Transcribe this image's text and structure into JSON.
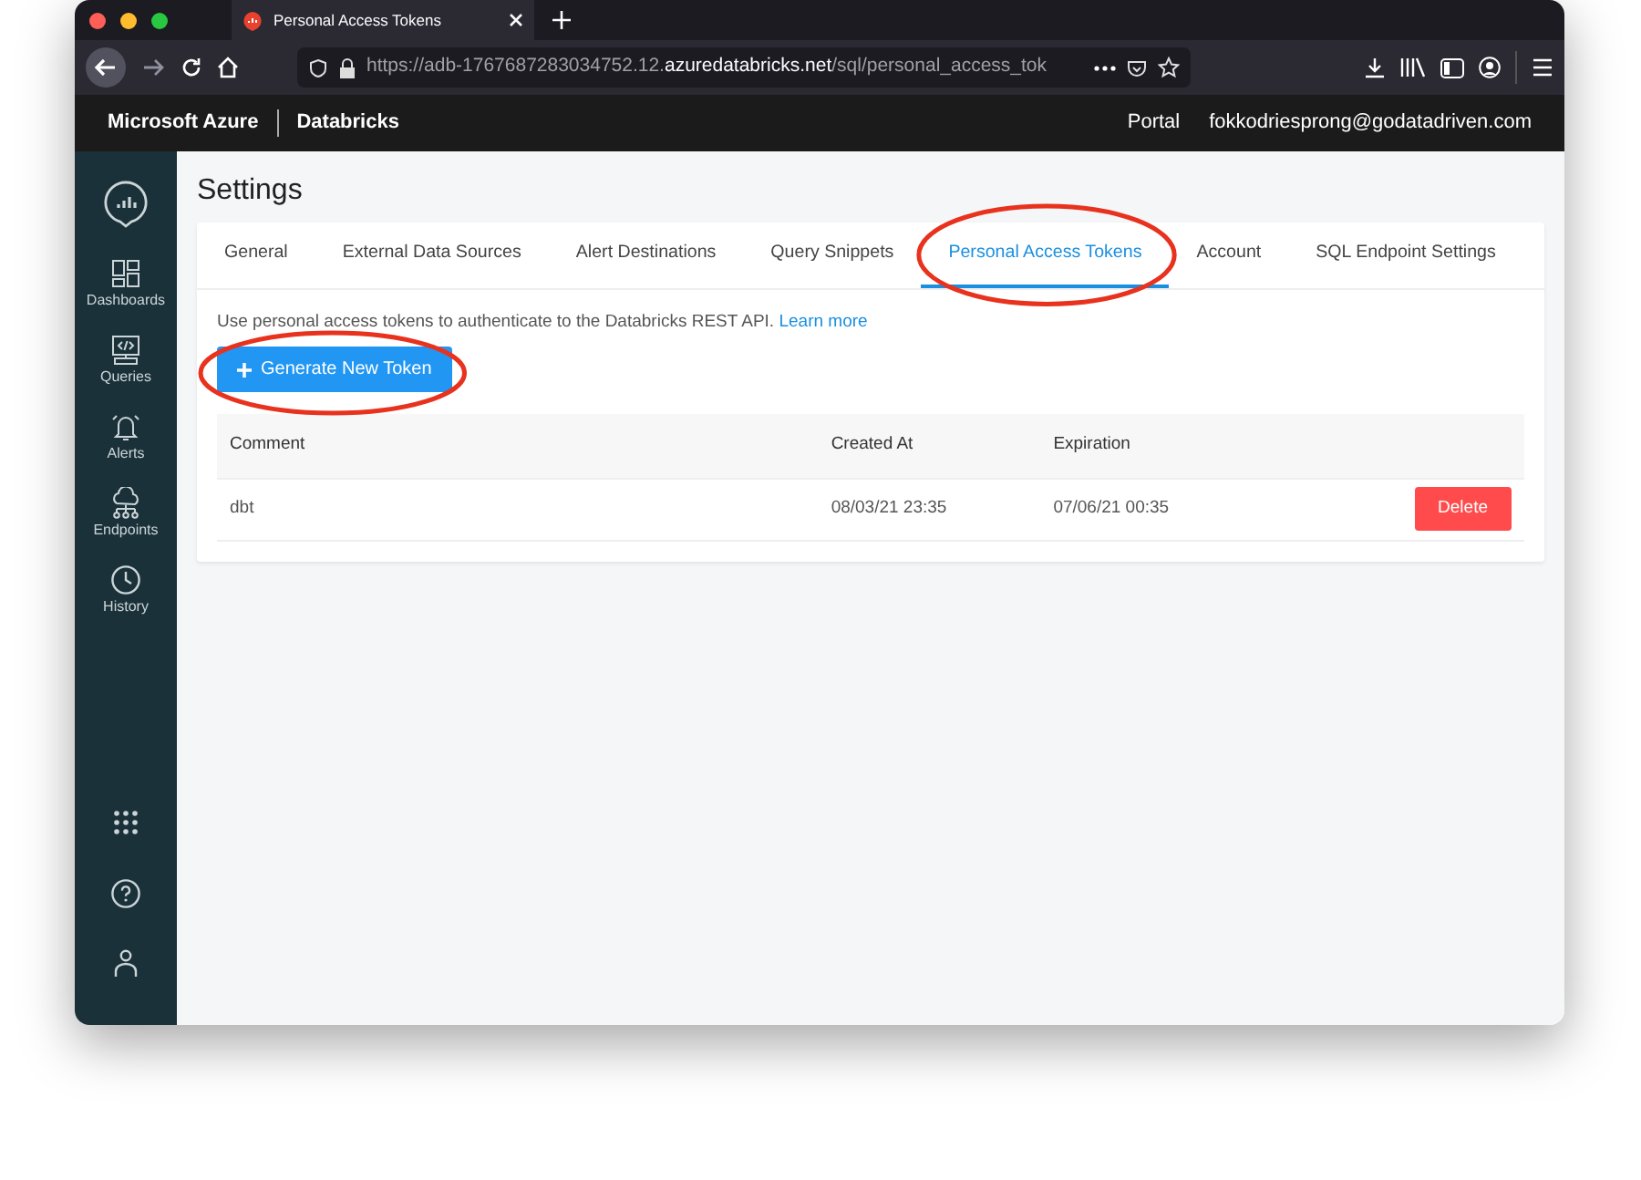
{
  "browser": {
    "tab_title": "Personal Access Tokens",
    "url_prefix": "https://adb-1767687283034752.12.",
    "url_domain": "azuredatabricks.net",
    "url_path": "/sql/personal_access_tok"
  },
  "header": {
    "brand": "Microsoft Azure",
    "product": "Databricks",
    "links": [
      "Portal",
      "fokkodriesprong@godatadriven.com"
    ]
  },
  "sidebar": {
    "items": [
      {
        "kind": "dashboards",
        "label": "Dashboards"
      },
      {
        "kind": "queries",
        "label": "Queries"
      },
      {
        "kind": "alerts",
        "label": "Alerts"
      },
      {
        "kind": "endpoints",
        "label": "Endpoints"
      },
      {
        "kind": "history",
        "label": "History"
      }
    ]
  },
  "page_title": "Settings",
  "tabs": [
    {
      "label": "General",
      "selected": false,
      "circled": false
    },
    {
      "label": "External Data Sources",
      "selected": false,
      "circled": false
    },
    {
      "label": "Alert Destinations",
      "selected": false,
      "circled": false
    },
    {
      "label": "Query Snippets",
      "selected": false,
      "circled": false
    },
    {
      "label": "Personal Access Tokens",
      "selected": true,
      "circled": true
    },
    {
      "label": "Account",
      "selected": false,
      "circled": false
    },
    {
      "label": "SQL Endpoint Settings",
      "selected": false,
      "circled": false
    }
  ],
  "intro": {
    "text": "Use personal access tokens to authenticate to the Databricks REST API.",
    "link": "Learn more"
  },
  "generate_button": {
    "label": "Generate New Token",
    "circled": true
  },
  "table": {
    "columns": [
      "Comment",
      "Created At",
      "Expiration"
    ],
    "rows": [
      {
        "comment": "dbt",
        "created_at": "08/03/21 23:35",
        "expiration": "07/06/21 00:35",
        "action": "Delete"
      }
    ]
  }
}
